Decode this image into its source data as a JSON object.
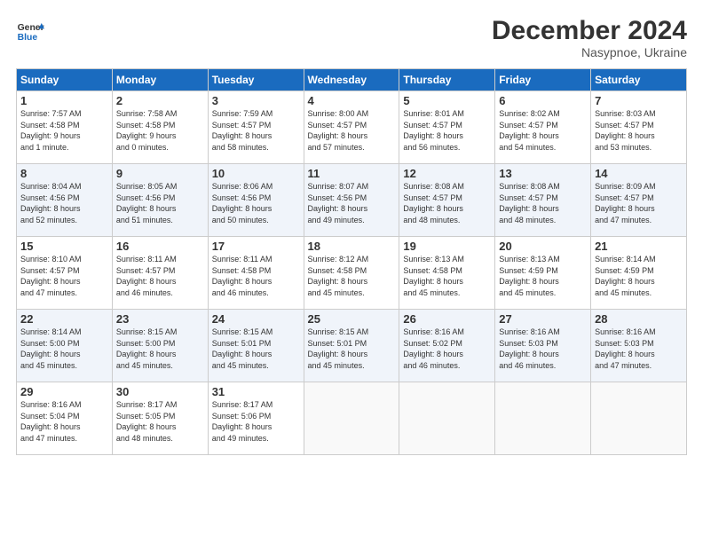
{
  "header": {
    "logo_line1": "General",
    "logo_line2": "Blue",
    "month": "December 2024",
    "location": "Nasypnoe, Ukraine"
  },
  "days_of_week": [
    "Sunday",
    "Monday",
    "Tuesday",
    "Wednesday",
    "Thursday",
    "Friday",
    "Saturday"
  ],
  "weeks": [
    [
      {
        "day": "1",
        "info": "Sunrise: 7:57 AM\nSunset: 4:58 PM\nDaylight: 9 hours\nand 1 minute."
      },
      {
        "day": "2",
        "info": "Sunrise: 7:58 AM\nSunset: 4:58 PM\nDaylight: 9 hours\nand 0 minutes."
      },
      {
        "day": "3",
        "info": "Sunrise: 7:59 AM\nSunset: 4:57 PM\nDaylight: 8 hours\nand 58 minutes."
      },
      {
        "day": "4",
        "info": "Sunrise: 8:00 AM\nSunset: 4:57 PM\nDaylight: 8 hours\nand 57 minutes."
      },
      {
        "day": "5",
        "info": "Sunrise: 8:01 AM\nSunset: 4:57 PM\nDaylight: 8 hours\nand 56 minutes."
      },
      {
        "day": "6",
        "info": "Sunrise: 8:02 AM\nSunset: 4:57 PM\nDaylight: 8 hours\nand 54 minutes."
      },
      {
        "day": "7",
        "info": "Sunrise: 8:03 AM\nSunset: 4:57 PM\nDaylight: 8 hours\nand 53 minutes."
      }
    ],
    [
      {
        "day": "8",
        "info": "Sunrise: 8:04 AM\nSunset: 4:56 PM\nDaylight: 8 hours\nand 52 minutes."
      },
      {
        "day": "9",
        "info": "Sunrise: 8:05 AM\nSunset: 4:56 PM\nDaylight: 8 hours\nand 51 minutes."
      },
      {
        "day": "10",
        "info": "Sunrise: 8:06 AM\nSunset: 4:56 PM\nDaylight: 8 hours\nand 50 minutes."
      },
      {
        "day": "11",
        "info": "Sunrise: 8:07 AM\nSunset: 4:56 PM\nDaylight: 8 hours\nand 49 minutes."
      },
      {
        "day": "12",
        "info": "Sunrise: 8:08 AM\nSunset: 4:57 PM\nDaylight: 8 hours\nand 48 minutes."
      },
      {
        "day": "13",
        "info": "Sunrise: 8:08 AM\nSunset: 4:57 PM\nDaylight: 8 hours\nand 48 minutes."
      },
      {
        "day": "14",
        "info": "Sunrise: 8:09 AM\nSunset: 4:57 PM\nDaylight: 8 hours\nand 47 minutes."
      }
    ],
    [
      {
        "day": "15",
        "info": "Sunrise: 8:10 AM\nSunset: 4:57 PM\nDaylight: 8 hours\nand 47 minutes."
      },
      {
        "day": "16",
        "info": "Sunrise: 8:11 AM\nSunset: 4:57 PM\nDaylight: 8 hours\nand 46 minutes."
      },
      {
        "day": "17",
        "info": "Sunrise: 8:11 AM\nSunset: 4:58 PM\nDaylight: 8 hours\nand 46 minutes."
      },
      {
        "day": "18",
        "info": "Sunrise: 8:12 AM\nSunset: 4:58 PM\nDaylight: 8 hours\nand 45 minutes."
      },
      {
        "day": "19",
        "info": "Sunrise: 8:13 AM\nSunset: 4:58 PM\nDaylight: 8 hours\nand 45 minutes."
      },
      {
        "day": "20",
        "info": "Sunrise: 8:13 AM\nSunset: 4:59 PM\nDaylight: 8 hours\nand 45 minutes."
      },
      {
        "day": "21",
        "info": "Sunrise: 8:14 AM\nSunset: 4:59 PM\nDaylight: 8 hours\nand 45 minutes."
      }
    ],
    [
      {
        "day": "22",
        "info": "Sunrise: 8:14 AM\nSunset: 5:00 PM\nDaylight: 8 hours\nand 45 minutes."
      },
      {
        "day": "23",
        "info": "Sunrise: 8:15 AM\nSunset: 5:00 PM\nDaylight: 8 hours\nand 45 minutes."
      },
      {
        "day": "24",
        "info": "Sunrise: 8:15 AM\nSunset: 5:01 PM\nDaylight: 8 hours\nand 45 minutes."
      },
      {
        "day": "25",
        "info": "Sunrise: 8:15 AM\nSunset: 5:01 PM\nDaylight: 8 hours\nand 45 minutes."
      },
      {
        "day": "26",
        "info": "Sunrise: 8:16 AM\nSunset: 5:02 PM\nDaylight: 8 hours\nand 46 minutes."
      },
      {
        "day": "27",
        "info": "Sunrise: 8:16 AM\nSunset: 5:03 PM\nDaylight: 8 hours\nand 46 minutes."
      },
      {
        "day": "28",
        "info": "Sunrise: 8:16 AM\nSunset: 5:03 PM\nDaylight: 8 hours\nand 47 minutes."
      }
    ],
    [
      {
        "day": "29",
        "info": "Sunrise: 8:16 AM\nSunset: 5:04 PM\nDaylight: 8 hours\nand 47 minutes."
      },
      {
        "day": "30",
        "info": "Sunrise: 8:17 AM\nSunset: 5:05 PM\nDaylight: 8 hours\nand 48 minutes."
      },
      {
        "day": "31",
        "info": "Sunrise: 8:17 AM\nSunset: 5:06 PM\nDaylight: 8 hours\nand 49 minutes."
      },
      {
        "day": "",
        "info": ""
      },
      {
        "day": "",
        "info": ""
      },
      {
        "day": "",
        "info": ""
      },
      {
        "day": "",
        "info": ""
      }
    ]
  ]
}
